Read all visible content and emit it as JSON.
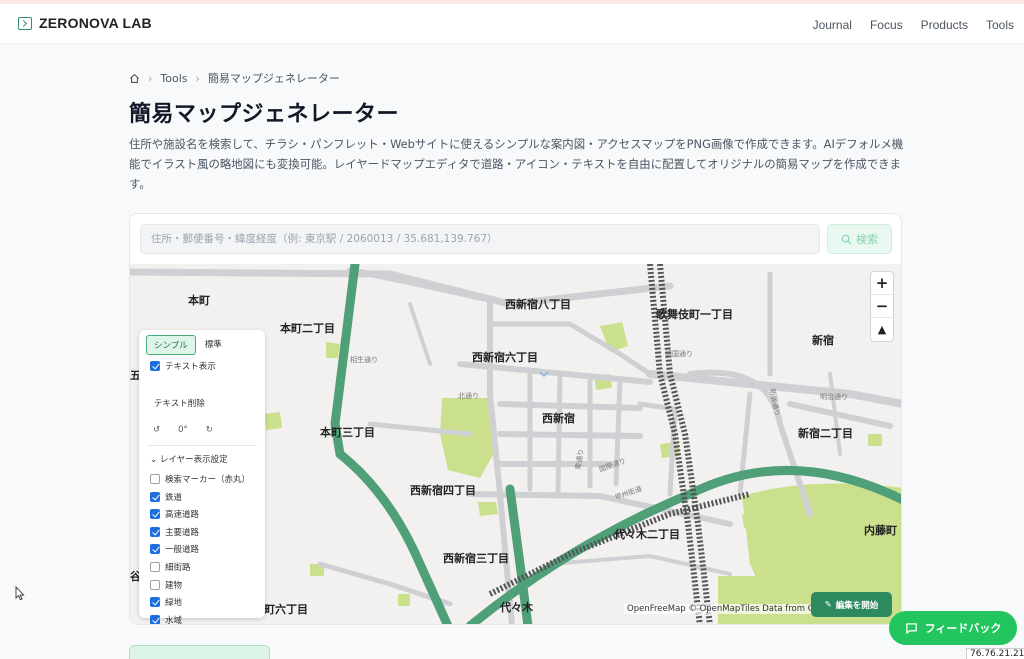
{
  "header": {
    "brand": "ZERONOVA LAB",
    "nav": [
      "Journal",
      "Focus",
      "Products",
      "Tools"
    ]
  },
  "breadcrumb": {
    "items": [
      "Tools",
      "簡易マップジェネレーター"
    ]
  },
  "page": {
    "title": "簡易マップジェネレーター",
    "description": "住所や施設名を検索して、チラシ・パンフレット・Webサイトに使えるシンプルな案内図・アクセスマップをPNG画像で作成できます。AIデフォルメ機能でイラスト風の略地図にも変換可能。レイヤードマップエディタで道路・アイコン・テキストを自由に配置してオリジナルの簡易マップを作成できます。"
  },
  "search": {
    "placeholder": "住所・郵便番号・緯度経度（例: 東京駅 / 2060013 / 35.681,139.767）",
    "button": "検索"
  },
  "panel": {
    "mode_simple": "シンプル",
    "mode_standard": "標準",
    "text_display": "テキスト表示",
    "text_delete": "テキスト削除",
    "rotation": "0°",
    "layer_title": "レイヤー表示設定",
    "layers": [
      {
        "label": "検索マーカー（赤丸）",
        "checked": false
      },
      {
        "label": "鉄道",
        "checked": true
      },
      {
        "label": "高速道路",
        "checked": true
      },
      {
        "label": "主要道路",
        "checked": true
      },
      {
        "label": "一般道路",
        "checked": true
      },
      {
        "label": "細街路",
        "checked": false
      },
      {
        "label": "建物",
        "checked": false
      },
      {
        "label": "緑地",
        "checked": true
      },
      {
        "label": "水域",
        "checked": true
      }
    ]
  },
  "map": {
    "labels": {
      "honmachi": "本町",
      "honmachi2": "本町二丁目",
      "honmachi3": "本町三丁目",
      "nishishinjuku8": "西新宿八丁目",
      "nishishinjuku6": "西新宿六丁目",
      "nishishinjuku": "西新宿",
      "nishishinjuku4": "西新宿四丁目",
      "nishishinjuku3": "西新宿三丁目",
      "kabukicho1": "歌舞伎町一丁目",
      "shinjuku": "新宿",
      "shinjuku2": "新宿二丁目",
      "yoyogi2": "代々木二丁目",
      "yoyogi": "代々木",
      "naitomachi": "内藤町",
      "honmachi6": "町六丁目",
      "edge5": "五",
      "edgeki": "谷"
    },
    "small_labels": {
      "aiou": "相生通り",
      "kita": "北通り",
      "higashi": "東通り",
      "kokusai": "国際通り",
      "yasukuni": "靖国通り",
      "meiji": "明治通り",
      "shin_odo": "新宿通り",
      "koshu": "甲州街道"
    },
    "attribution": "OpenFreeMap © OpenMapTiles Data from O",
    "edit_button": "編集を開始",
    "colors": {
      "green_road": "#4f9f78",
      "park": "#cbe08c",
      "road": "#ffffff",
      "railway": "#555555"
    }
  },
  "feedback": {
    "label": "フィードバック"
  },
  "ip": "76.76.21.21"
}
